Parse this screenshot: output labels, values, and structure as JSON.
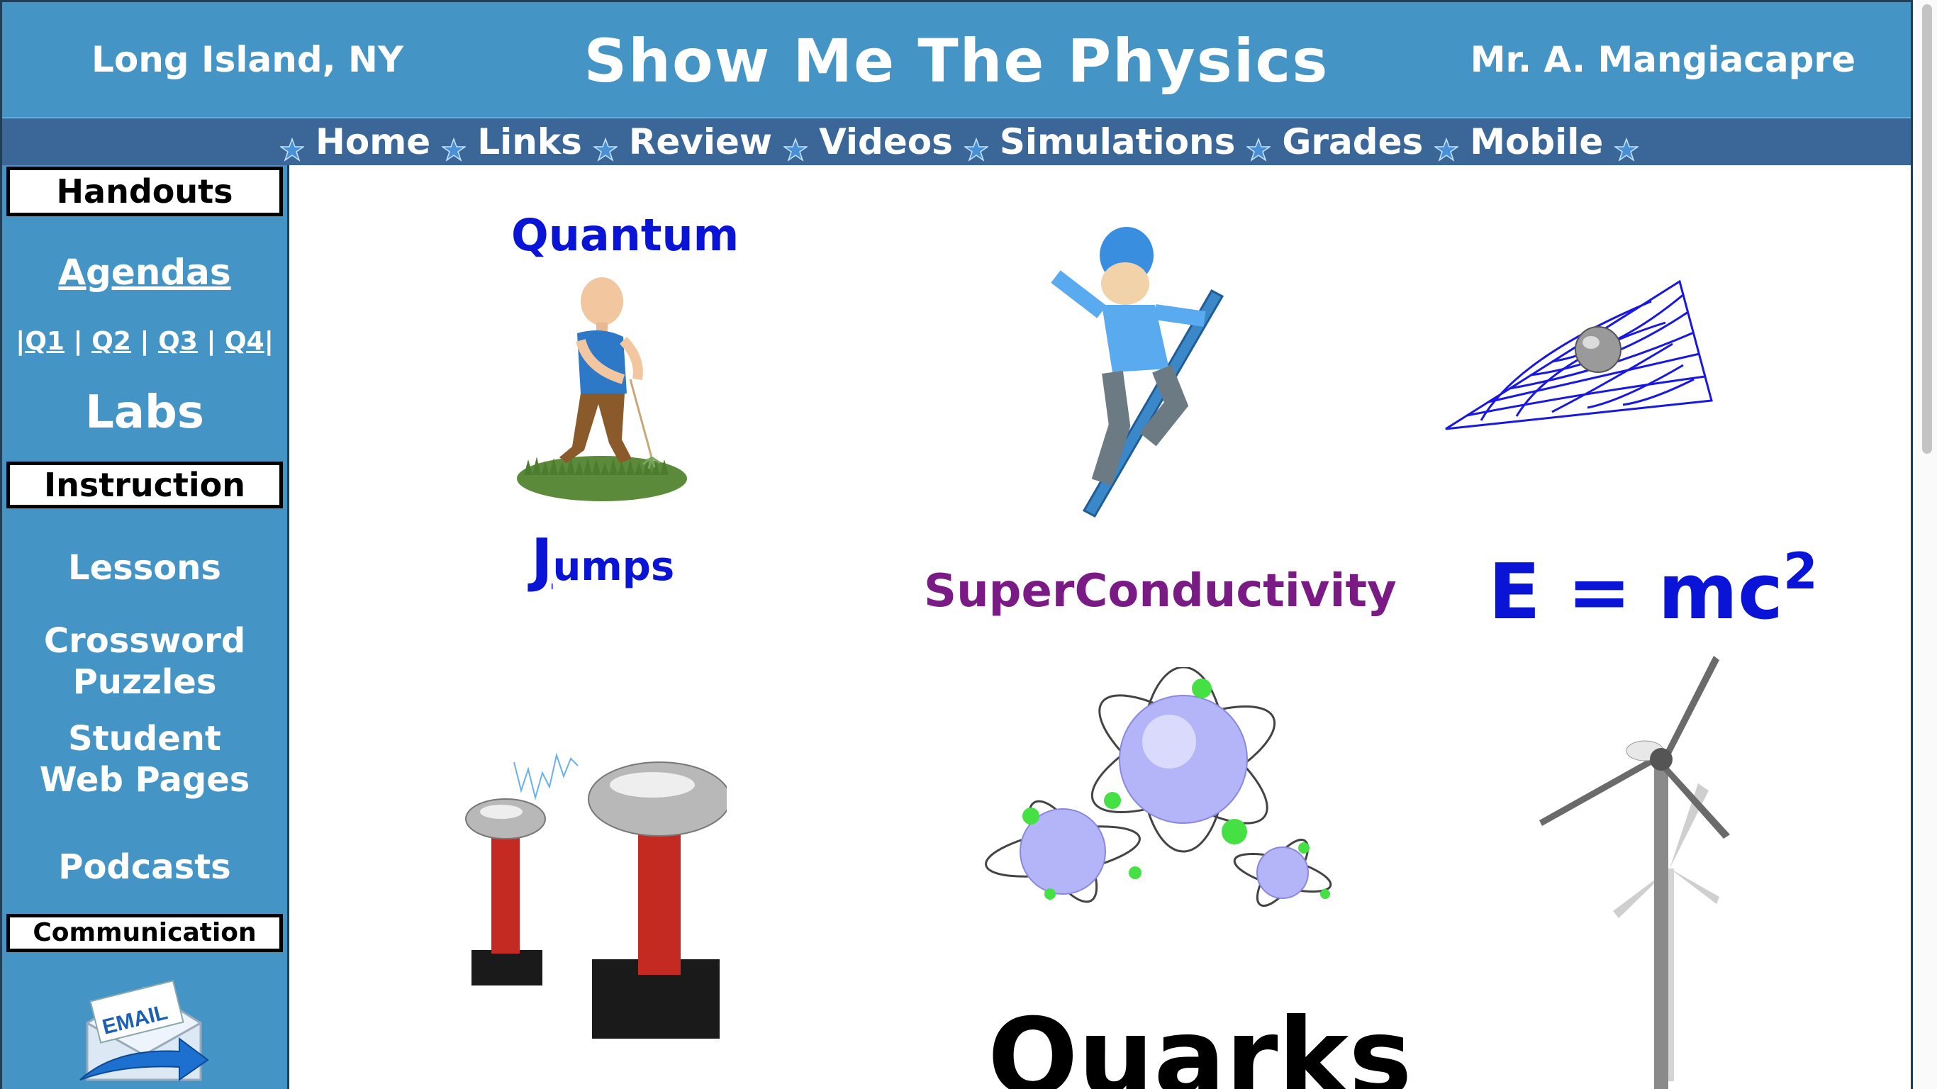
{
  "header": {
    "location": "Long Island, NY",
    "title": "Show Me The Physics",
    "teacher": "Mr. A. Mangiacapre"
  },
  "nav": {
    "items": [
      "Home",
      "Links",
      "Review",
      "Videos",
      "Simulations",
      "Grades",
      "Mobile"
    ]
  },
  "sidebar": {
    "handouts_heading": "Handouts",
    "agendas": "Agendas",
    "quarter_sep": "|",
    "quarters": [
      "Q1",
      "Q2",
      "Q3",
      "Q4"
    ],
    "labs": "Labs",
    "instruction_heading": "Instruction",
    "lessons": "Lessons",
    "crossword_line1": "Crossword",
    "crossword_line2": "Puzzles",
    "student_line1": "Student",
    "student_line2": "Web Pages",
    "podcasts": "Podcasts",
    "communication_heading": "Communication",
    "email_icon_text": "EMAIL"
  },
  "main": {
    "quantum": "Quantum",
    "jumps_first": "J",
    "jumps_rest": "umps",
    "superconductivity": "SuperConductivity",
    "emc_base": "E = mc",
    "emc_exp": "2",
    "quarks": "Quarks"
  },
  "colors": {
    "header_bg": "#4494c6",
    "nav_bg": "#3a6798",
    "blue_text": "#0a14d6",
    "purple_text": "#7a1a85"
  }
}
